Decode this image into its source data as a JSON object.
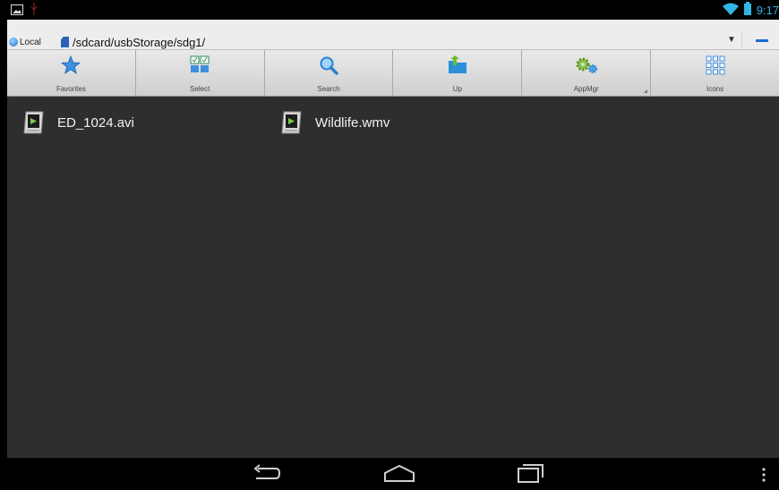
{
  "status_bar": {
    "time": "9:17",
    "icons": [
      "screenshot-icon",
      "usb-debug-icon",
      "wifi-icon",
      "battery-icon"
    ]
  },
  "address_bar": {
    "location_label": "Local",
    "path": "/sdcard/usbStorage/sdg1/",
    "icons": [
      "local-globe-icon",
      "sdcard-icon",
      "dropdown-arrow-icon",
      "minus-icon"
    ]
  },
  "toolbar": {
    "items": [
      {
        "label": "Favorites",
        "icon": "star-icon"
      },
      {
        "label": "Select",
        "icon": "select-grid-icon"
      },
      {
        "label": "Search",
        "icon": "magnifier-icon"
      },
      {
        "label": "Up",
        "icon": "folder-up-icon"
      },
      {
        "label": "AppMgr",
        "icon": "gears-icon"
      },
      {
        "label": "Icons",
        "icon": "icon-grid-icon"
      }
    ]
  },
  "files": [
    {
      "name": "ED_1024.avi",
      "icon": "video-file-icon"
    },
    {
      "name": "Wildlife.wmv",
      "icon": "video-file-icon"
    }
  ],
  "nav_bar": {
    "icons": [
      "back-icon",
      "home-icon",
      "recents-icon",
      "overflow-menu-icon"
    ]
  },
  "colors": {
    "accent": "#33b5e5",
    "background": "#2e2e2e",
    "toolbar": "#dcdcdc",
    "path_accent": "#1a6fd1"
  }
}
